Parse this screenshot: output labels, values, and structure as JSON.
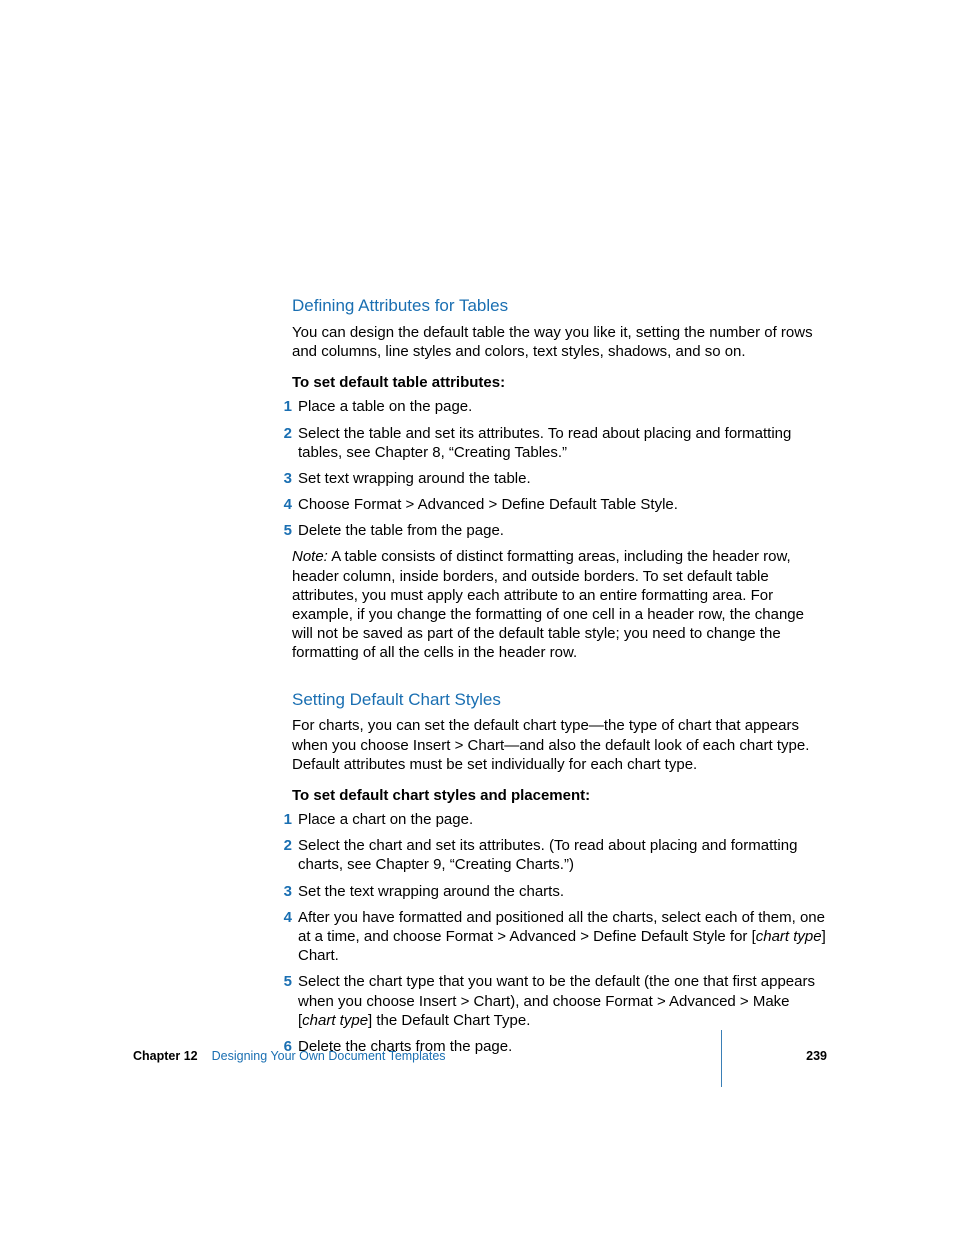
{
  "section1": {
    "heading": "Defining Attributes for Tables",
    "intro": "You can design the default table the way you like it, setting the number of rows and columns, line styles and colors, text styles, shadows, and so on.",
    "subhead": "To set default table attributes:",
    "steps": [
      "Place a table on the page.",
      "Select the table and set its attributes. To read about placing and formatting tables, see Chapter 8, “Creating Tables.”",
      "Set text wrapping around the table.",
      "Choose Format > Advanced > Define Default Table Style.",
      "Delete the table from the page."
    ],
    "note_label": "Note:",
    "note_body": "  A table consists of distinct formatting areas, including the header row, header column, inside borders, and outside borders. To set default table attributes, you must apply each attribute to an entire formatting area. For example, if you change the formatting of one cell in a header row, the change will not be saved as part of the default table style; you need to change the formatting of all the cells in the header row."
  },
  "section2": {
    "heading": "Setting Default Chart Styles",
    "intro": "For charts, you can set the default chart type—the type of chart that appears when you choose Insert > Chart—and also the default look of each chart type. Default attributes must be set individually for each chart type.",
    "subhead": "To set default chart styles and placement:",
    "steps": {
      "s1": "Place a chart on the page.",
      "s2": "Select the chart and set its attributes. (To read about placing and formatting charts, see Chapter 9, “Creating Charts.”)",
      "s3": "Set the text wrapping around the charts.",
      "s4a": "After you have formatted and positioned all the charts, select each of them, one at a time, and choose Format > Advanced > Define Default Style for [",
      "s4i": "chart type",
      "s4b": "] Chart.",
      "s5a": "Select the chart type that you want to be the default (the one that first appears when you choose Insert > Chart), and choose Format > Advanced > Make [",
      "s5i": "chart type",
      "s5b": "] the Default Chart Type.",
      "s6": "Delete the charts from the page."
    }
  },
  "footer": {
    "chapter": "Chapter 12",
    "title": "Designing Your Own Document Templates",
    "page": "239"
  },
  "nums": {
    "n1": "1",
    "n2": "2",
    "n3": "3",
    "n4": "4",
    "n5": "5",
    "n6": "6"
  }
}
